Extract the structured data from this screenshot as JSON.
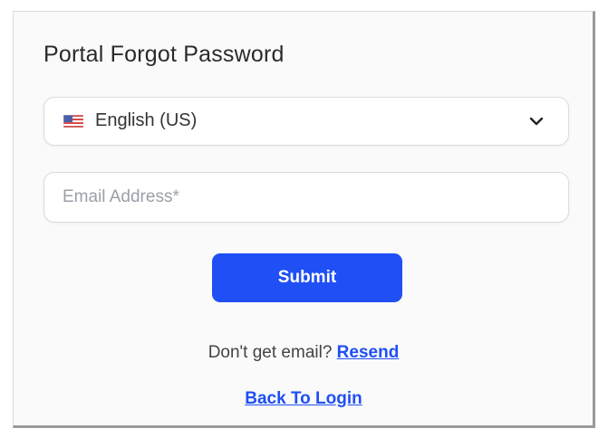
{
  "page": {
    "title": "Portal Forgot Password"
  },
  "language_select": {
    "selected": "English (US)",
    "flag_icon": "us-flag-icon"
  },
  "email": {
    "placeholder": "Email Address*",
    "value": ""
  },
  "submit": {
    "label": "Submit"
  },
  "resend": {
    "prompt": "Don't get email?",
    "link_label": "Resend"
  },
  "back": {
    "link_label": "Back To Login"
  },
  "colors": {
    "accent": "#1f4ff5",
    "title_text": "#2b2b2b",
    "placeholder": "#9aa0a8"
  }
}
